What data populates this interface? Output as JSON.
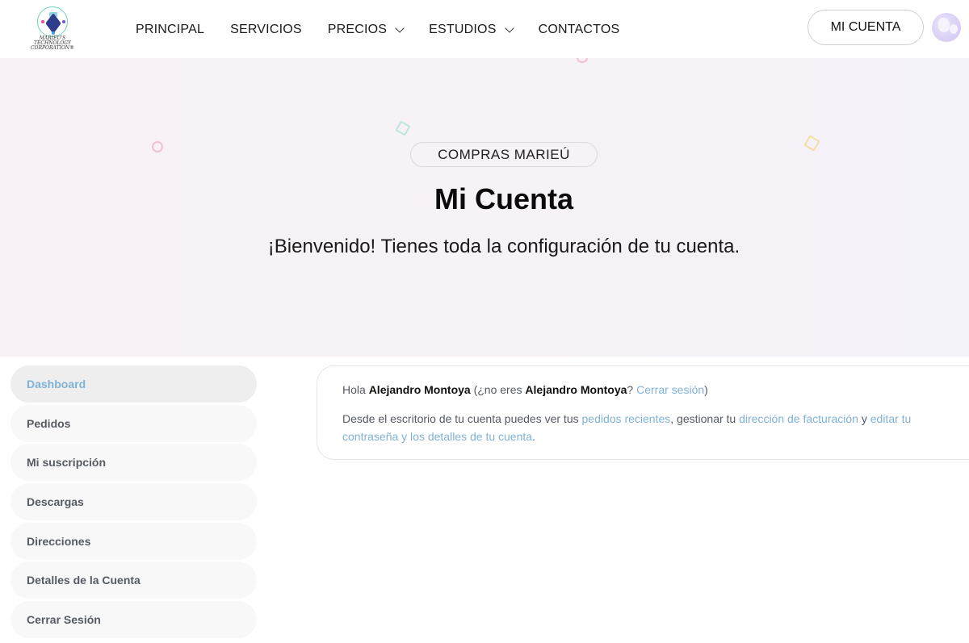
{
  "logo": {
    "line1": "MARIEU'S",
    "line2": "TECHNOLOGY CORPORATION®"
  },
  "nav": {
    "items": [
      {
        "label": "PRINCIPAL"
      },
      {
        "label": "SERVICIOS"
      },
      {
        "label": "PRECIOS"
      },
      {
        "label": "ESTUDIOS"
      },
      {
        "label": "CONTACTOS"
      }
    ],
    "account_label": "MI CUENTA"
  },
  "hero": {
    "tag": "COMPRAS MARIEÚ",
    "title": "Mi Cuenta",
    "subtitle": "¡Bienvenido! Tienes toda la configuración de tu cuenta."
  },
  "sidebar": {
    "items": [
      {
        "label": "Dashboard"
      },
      {
        "label": "Pedidos"
      },
      {
        "label": "Mi suscripción"
      },
      {
        "label": "Descargas"
      },
      {
        "label": "Direcciones"
      },
      {
        "label": "Detalles de la Cuenta"
      },
      {
        "label": "Cerrar Sesión"
      }
    ]
  },
  "content": {
    "hello": "Hola",
    "user_name": "Alejandro Montoya",
    "not_you": "(¿no eres",
    "qmark": "?",
    "logout_link": "Cerrar sesión",
    "close_paren": ")",
    "desc_1": "Desde el escritorio de tu cuenta puedes ver tus",
    "link_orders": "pedidos recientes",
    "desc_2": ", gestionar tu",
    "link_billing": "dirección de facturación",
    "desc_3": "y",
    "link_edit": "editar tu contraseña y los detalles de tu cuenta",
    "desc_4": "."
  },
  "colors": {
    "accent_link": "#7fb2d6",
    "hero_bg": "#f6f2f6"
  }
}
